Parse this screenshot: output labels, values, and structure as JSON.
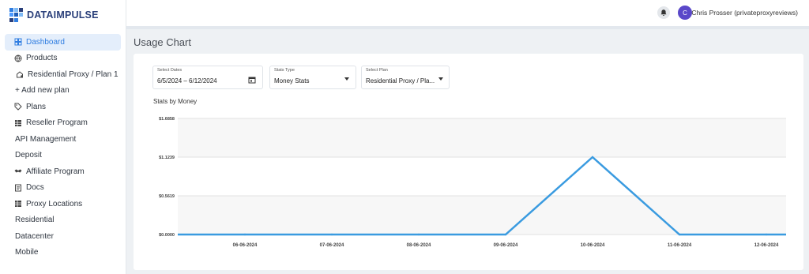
{
  "app": {
    "brand": "DATAIMPULSE",
    "brand_colors": [
      "#2f7de1",
      "#4f9bff",
      "#2a3f7a",
      "#7fbaf5",
      "#1f5db8"
    ]
  },
  "sidebar": {
    "items": [
      {
        "label": "Dashboard",
        "icon": "dashboard-icon",
        "active": true
      },
      {
        "label": "Products",
        "icon": "globe-icon"
      },
      {
        "label": "Residential Proxy / Plan 1",
        "icon": "home-gear-icon",
        "sub": true
      },
      {
        "label": "+ Add new plan",
        "icon": "",
        "sub": true
      },
      {
        "label": "Plans",
        "icon": "tag-icon"
      },
      {
        "label": "Reseller Program",
        "icon": "grid-icon"
      },
      {
        "label": "API Management",
        "icon": "",
        "sub": true
      },
      {
        "label": "Deposit",
        "icon": "",
        "sub": true
      },
      {
        "label": "Affiliate Program",
        "icon": "handshake-icon"
      },
      {
        "label": "Docs",
        "icon": "doc-icon"
      },
      {
        "label": "Proxy Locations",
        "icon": "grid-icon"
      },
      {
        "label": "Residential",
        "icon": "",
        "sub": true
      },
      {
        "label": "Datacenter",
        "icon": "",
        "sub": true
      },
      {
        "label": "Mobile",
        "icon": "",
        "sub": true
      }
    ]
  },
  "header": {
    "avatar_initial": "C",
    "user_name": "Chris Prosser (privateproxyreviews)",
    "avatar_color": "#5a48c9"
  },
  "main": {
    "title": "Usage Chart",
    "filters": {
      "dates": {
        "label": "Select Dates",
        "value": "6/5/2024 – 6/12/2024"
      },
      "stats_type": {
        "label": "Stats Type",
        "value": "Money Stats"
      },
      "plan": {
        "label": "Select Plan",
        "value": "Residential Proxy / Pla..."
      }
    },
    "chart_title": "Stats by Money"
  },
  "chart_data": {
    "type": "line",
    "title": "Stats by Money",
    "x": [
      "06-06-2024",
      "07-06-2024",
      "08-06-2024",
      "09-06-2024",
      "10-06-2024",
      "11-06-2024",
      "12-06-2024"
    ],
    "series": [
      {
        "values": [
          0,
          0,
          0,
          0,
          1.1239,
          0,
          0
        ],
        "color": "#3a9be0"
      }
    ],
    "y_ticks": [
      "$1.6858",
      "$1.1239",
      "$0.5619",
      "$0.0000"
    ],
    "ylim": [
      0,
      1.6858
    ],
    "grid": true
  }
}
